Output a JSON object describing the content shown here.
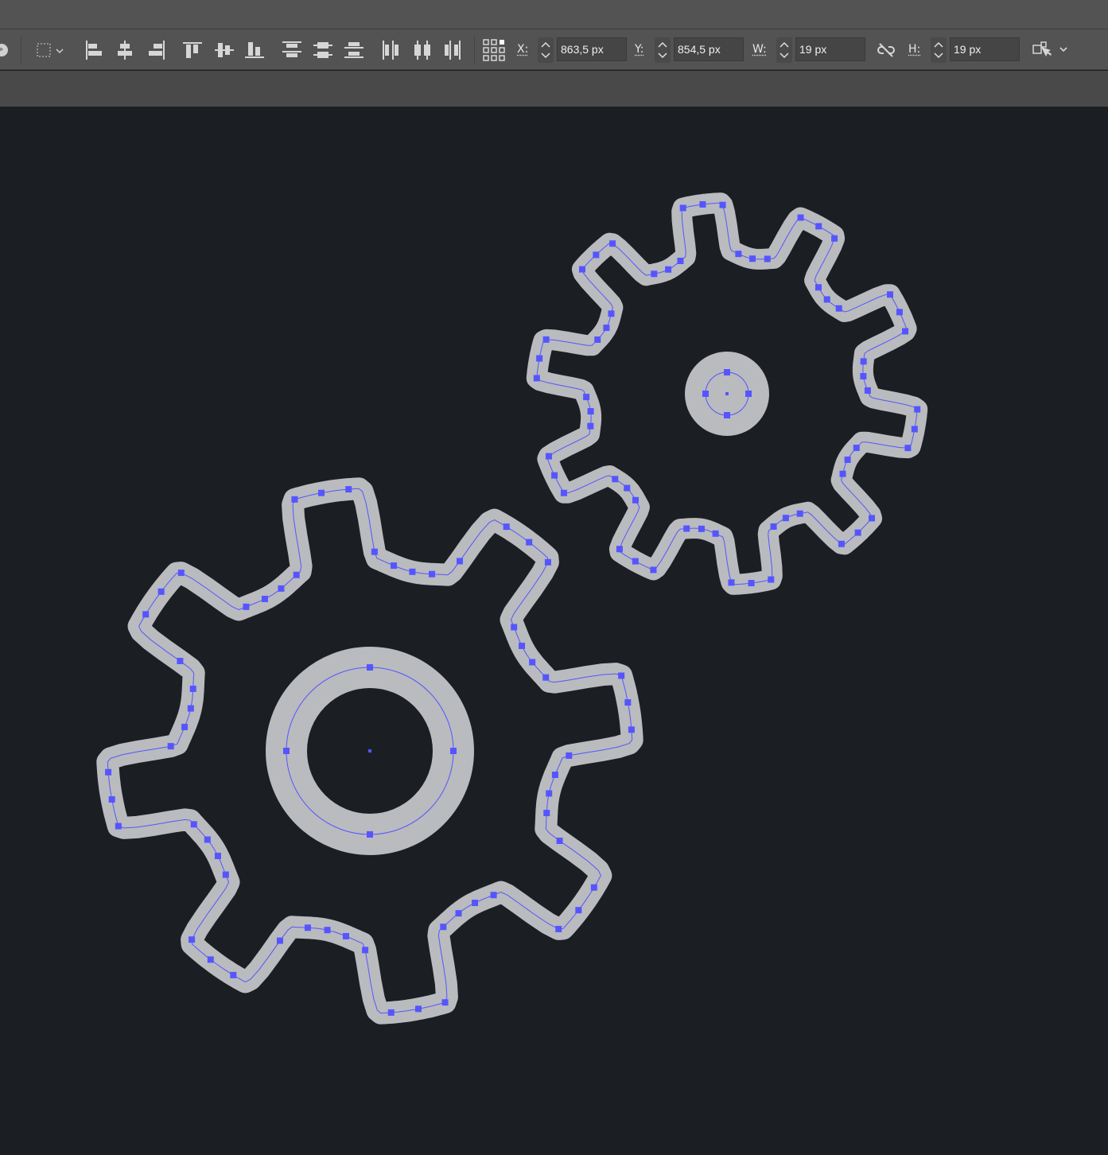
{
  "toolbar": {
    "x": {
      "label": "X:",
      "value": "863,5 px"
    },
    "y": {
      "label": "Y:",
      "value": "854,5 px"
    },
    "w": {
      "label": "W:",
      "value": "19 px"
    },
    "h": {
      "label": "H:",
      "value": "19 px"
    }
  },
  "colors": {
    "toolbar_bg": "#535353",
    "canvas_bg": "#1b1f23",
    "gear_stroke": "#b9bbbe",
    "selection": "#5555ff"
  },
  "icons": [
    "align-left-edges-icon",
    "align-horizontal-centers-icon",
    "align-right-edges-icon",
    "align-top-edges-icon",
    "align-vertical-centers-icon",
    "align-bottom-edges-icon",
    "distribute-top-icon",
    "distribute-vertical-centers-icon",
    "distribute-bottom-icon",
    "distribute-left-icon",
    "distribute-horizontal-centers-icon",
    "distribute-right-icon",
    "reference-point-icon",
    "link-proportions-icon",
    "transform-options-icon"
  ]
}
